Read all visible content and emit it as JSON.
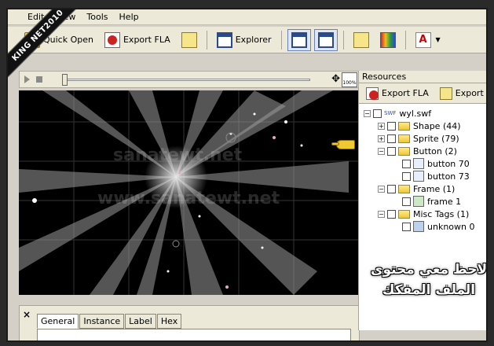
{
  "ribbon": "KING NET2010",
  "menu": {
    "items": [
      "Edit",
      "View",
      "Tools",
      "Help"
    ]
  },
  "toolbar": {
    "quick_open": "Quick Open",
    "export_fla": "Export FLA",
    "explorer": "Explorer"
  },
  "stage": {
    "watermark_top": "sanatewt.net",
    "watermark_bottom": "www.sanatewt.net"
  },
  "props": {
    "tabs": [
      "General",
      "Instance",
      "Label",
      "Hex"
    ],
    "close": "×"
  },
  "resources": {
    "title": "Resources",
    "export_fla": "Export FLA",
    "export_other": "Export I",
    "tree": {
      "root": "wyl.swf",
      "swf_badge": "SWF",
      "shape": "Shape (44)",
      "sprite": "Sprite (79)",
      "button": "Button (2)",
      "button70": "button 70",
      "button73": "button 73",
      "frame": "Frame (1)",
      "frame1": "frame 1",
      "misc": "Misc Tags (1)",
      "unknown": "unknown 0"
    }
  },
  "overlay_text": {
    "line1": "لاحظ معي محتوى",
    "line2": "الملف المفكك"
  },
  "colors": {
    "chrome": "#ece9d8",
    "stage": "#000000",
    "accent": "#2a4ad0",
    "pointer": "#f0c830"
  }
}
